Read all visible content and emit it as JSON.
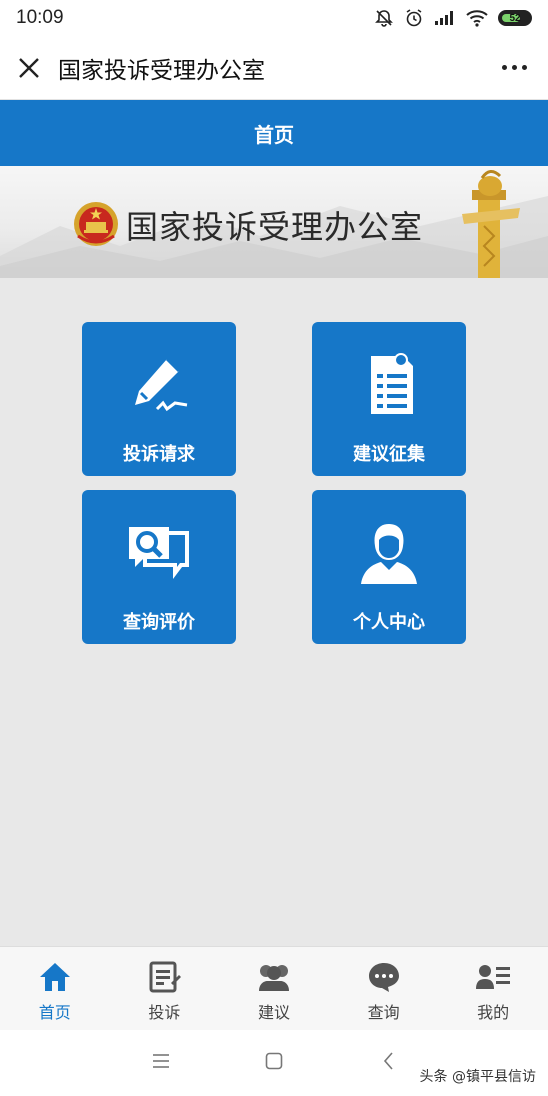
{
  "status_bar": {
    "time": "10:09",
    "battery": "52",
    "icons": [
      "bell-off-icon",
      "alarm-icon",
      "signal-icon",
      "wifi-icon",
      "battery-icon"
    ]
  },
  "title_bar": {
    "title": "国家投诉受理办公室",
    "close_icon": "close-icon",
    "more_icon": "more-icon"
  },
  "header": {
    "title": "首页"
  },
  "banner": {
    "title": "国家投诉受理办公室",
    "emblem": "national-emblem"
  },
  "tiles": [
    {
      "label": "投诉请求",
      "icon": "pen-icon"
    },
    {
      "label": "建议征集",
      "icon": "document-icon"
    },
    {
      "label": "查询评价",
      "icon": "search-chat-icon"
    },
    {
      "label": "个人中心",
      "icon": "person-icon"
    }
  ],
  "bottom_nav": [
    {
      "label": "首页",
      "icon": "home-icon",
      "active": true
    },
    {
      "label": "投诉",
      "icon": "form-icon",
      "active": false
    },
    {
      "label": "建议",
      "icon": "people-icon",
      "active": false
    },
    {
      "label": "查询",
      "icon": "chat-icon",
      "active": false
    },
    {
      "label": "我的",
      "icon": "user-card-icon",
      "active": false
    }
  ],
  "system_nav": [
    "menu-icon",
    "home-square-icon",
    "back-icon"
  ],
  "watermark": "头条 @镇平县信访",
  "colors": {
    "primary": "#1677c8",
    "background": "#e8e8e8",
    "active_nav": "#1677c8"
  }
}
